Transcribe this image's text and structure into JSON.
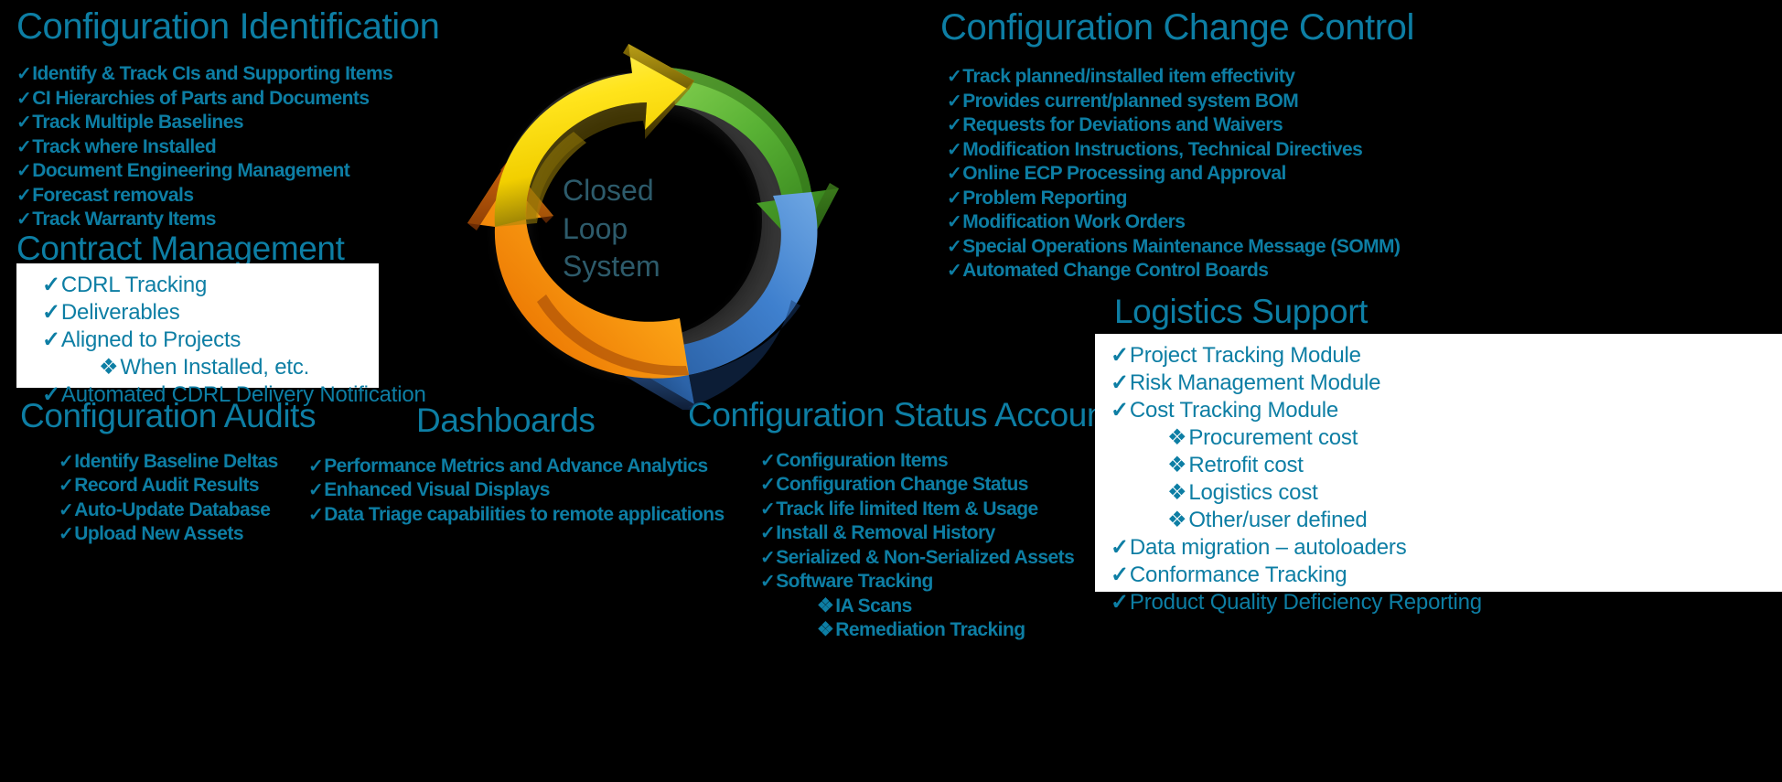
{
  "center": {
    "label_lines": [
      "Closed",
      "Loop",
      "System"
    ],
    "text_color": "#2d5b6b",
    "arrows": [
      {
        "name": "yellow-arrow",
        "color": "#FFE41C",
        "edge": "#8c7406",
        "position": "top-left"
      },
      {
        "name": "green-arrow",
        "color": "#4FA82E",
        "edge": "#2d5e14",
        "position": "top-right"
      },
      {
        "name": "blue-arrow",
        "color": "#3A7DCB",
        "edge": "#1c4a80",
        "position": "bottom-right"
      },
      {
        "name": "orange-arrow",
        "color": "#F79C10",
        "edge": "#a1470a",
        "position": "bottom-left"
      }
    ]
  },
  "theme": {
    "accent": "#0d7ea4",
    "background": "#000000",
    "panel_background": "#ffffff"
  },
  "panels": {
    "configuration_identification": {
      "title": "Configuration Identification",
      "items": [
        {
          "text": "Identify & Track CIs and Supporting Items",
          "marker": "check"
        },
        {
          "text": "CI Hierarchies of Parts and Documents",
          "marker": "check"
        },
        {
          "text": "Track Multiple Baselines",
          "marker": "check"
        },
        {
          "text": "Track  where Installed",
          "marker": "check"
        },
        {
          "text": "Document Engineering Management",
          "marker": "check"
        },
        {
          "text": "Forecast removals",
          "marker": "check"
        },
        {
          "text": "Track Warranty Items",
          "marker": "check"
        }
      ]
    },
    "contract_management": {
      "title": "Contract Management",
      "items": [
        {
          "text": "CDRL Tracking",
          "marker": "check",
          "level": 0
        },
        {
          "text": "Deliverables",
          "marker": "check",
          "level": 0
        },
        {
          "text": "Aligned to Projects",
          "marker": "check",
          "level": 0
        },
        {
          "text": "When Installed, etc.",
          "marker": "diamond",
          "level": 1
        },
        {
          "text": "Automated CDRL Delivery Notification",
          "marker": "check",
          "level": 0
        }
      ]
    },
    "configuration_audits": {
      "title": "Configuration Audits",
      "items": [
        {
          "text": "Identify Baseline Deltas",
          "marker": "check"
        },
        {
          "text": "Record Audit Results",
          "marker": "check"
        },
        {
          "text": "Auto-Update Database",
          "marker": "check"
        },
        {
          "text": "Upload New Assets",
          "marker": "check"
        }
      ]
    },
    "dashboards": {
      "title": "Dashboards",
      "items": [
        {
          "text": "Performance Metrics and Advance Analytics",
          "marker": "check"
        },
        {
          "text": "Enhanced Visual Displays",
          "marker": "check"
        },
        {
          "text": "Data Triage capabilities to remote applications",
          "marker": "check"
        }
      ]
    },
    "configuration_status_accounting": {
      "title": "Configuration Status Accounting",
      "items": [
        {
          "text": "Configuration Items",
          "marker": "check",
          "level": 0
        },
        {
          "text": "Configuration Change Status",
          "marker": "check",
          "level": 0
        },
        {
          "text": "Track  life limited Item & Usage",
          "marker": "check",
          "level": 0
        },
        {
          "text": "Install & Removal History",
          "marker": "check",
          "level": 0
        },
        {
          "text": "Serialized & Non-Serialized Assets",
          "marker": "check",
          "level": 0
        },
        {
          "text": "Software Tracking",
          "marker": "check",
          "level": 0
        },
        {
          "text": "IA Scans",
          "marker": "diamond",
          "level": 1
        },
        {
          "text": "Remediation Tracking",
          "marker": "diamond",
          "level": 1
        }
      ]
    },
    "configuration_change_control": {
      "title": "Configuration Change Control",
      "items": [
        {
          "text": "Track planned/installed item effectivity",
          "marker": "check"
        },
        {
          "text": "Provides current/planned system BOM",
          "marker": "check"
        },
        {
          "text": "Requests for Deviations and Waivers",
          "marker": "check"
        },
        {
          "text": "Modification Instructions, Technical Directives",
          "marker": "check"
        },
        {
          "text": "Online ECP Processing and Approval",
          "marker": "check"
        },
        {
          "text": "Problem Reporting",
          "marker": "check"
        },
        {
          "text": "Modification Work Orders",
          "marker": "check"
        },
        {
          "text": "Special Operations Maintenance  Message (SOMM)",
          "marker": "check"
        },
        {
          "text": "Automated Change Control Boards",
          "marker": "check"
        }
      ]
    },
    "logistics_support": {
      "title": "Logistics Support",
      "items": [
        {
          "text": "Project Tracking Module",
          "marker": "check",
          "level": 0
        },
        {
          "text": "Risk Management Module",
          "marker": "check",
          "level": 0
        },
        {
          "text": "Cost Tracking Module",
          "marker": "check",
          "level": 0
        },
        {
          "text": "Procurement cost",
          "marker": "diamond",
          "level": 1
        },
        {
          "text": "Retrofit cost",
          "marker": "diamond",
          "level": 1
        },
        {
          "text": "Logistics cost",
          "marker": "diamond",
          "level": 1
        },
        {
          "text": "Other/user defined",
          "marker": "diamond",
          "level": 1
        },
        {
          "text": "Data migration – autoloaders",
          "marker": "check",
          "level": 0
        },
        {
          "text": "Conformance Tracking",
          "marker": "check",
          "level": 0
        },
        {
          "text": "Product Quality Deficiency Reporting",
          "marker": "check",
          "level": 0
        }
      ]
    }
  }
}
